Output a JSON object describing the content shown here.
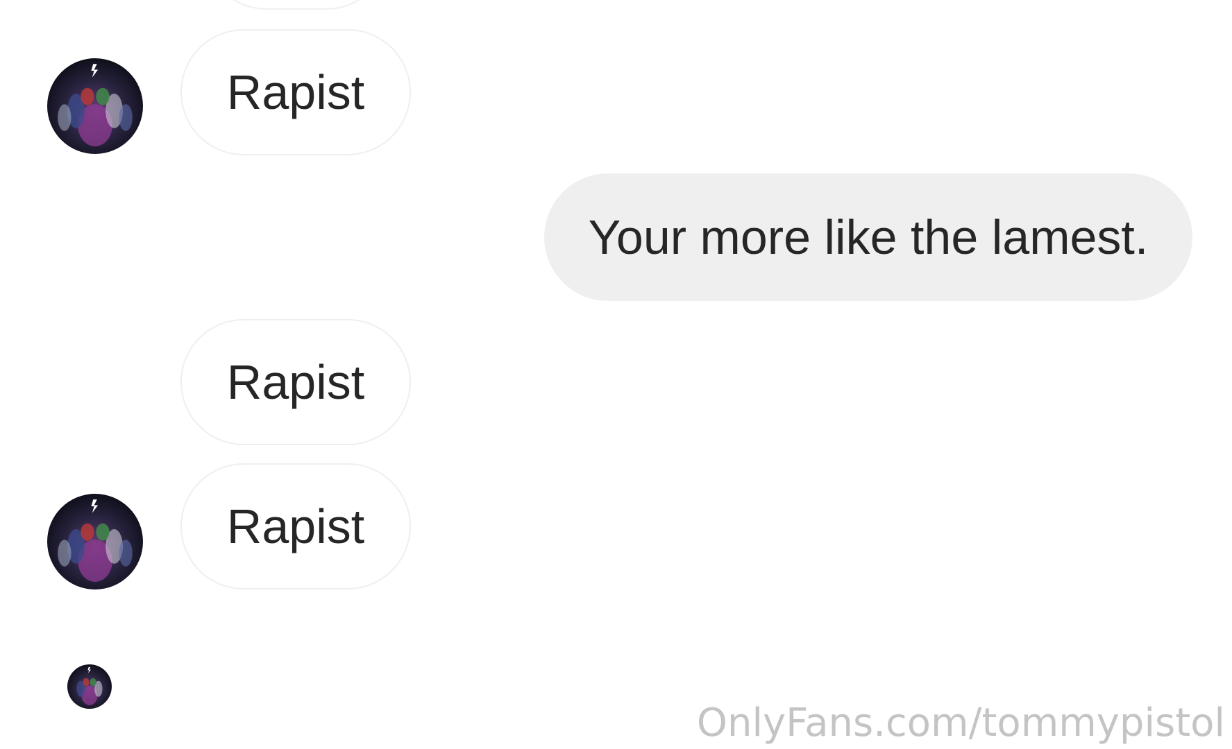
{
  "conversation": {
    "messages": [
      {
        "direction": "incoming",
        "text": "Rapist",
        "show_avatar": true
      },
      {
        "direction": "outgoing",
        "text": "Your more like the lamest."
      },
      {
        "direction": "incoming",
        "text": "Rapist",
        "show_avatar": false
      },
      {
        "direction": "incoming",
        "text": "Rapist",
        "show_avatar": true
      }
    ],
    "seen_avatar": "small-profile-avatar"
  },
  "watermark": {
    "text": "OnlyFans.com/tommypistol"
  },
  "colors": {
    "incoming_border": "#efefef",
    "outgoing_bg": "#efefef",
    "text": "#262626",
    "watermark": "#c4c4c4"
  },
  "icons": {
    "avatar": "profile-avatar-image"
  }
}
